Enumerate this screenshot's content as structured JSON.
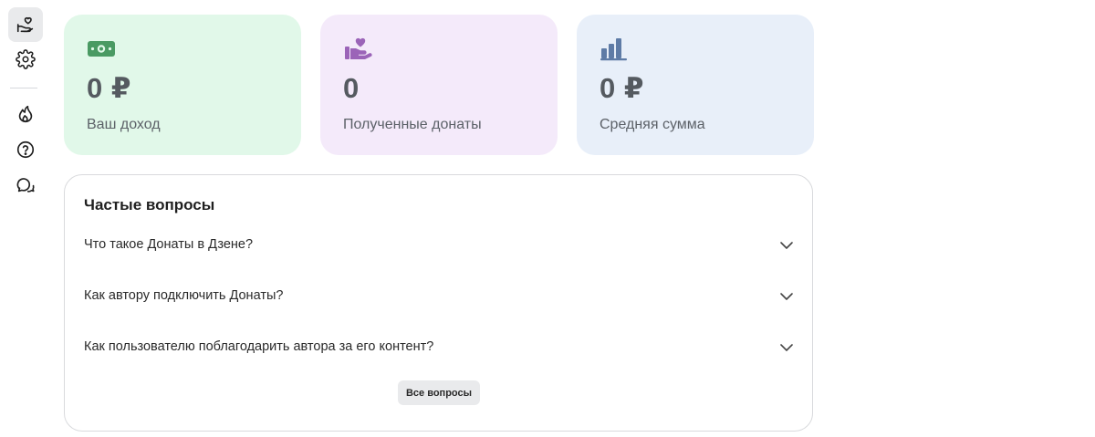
{
  "sidebar": {
    "items": [
      {
        "icon": "donate-hand-icon",
        "active": true
      },
      {
        "icon": "gear-icon",
        "active": false
      },
      {
        "icon": "flame-icon",
        "active": false
      },
      {
        "icon": "question-circle-icon",
        "active": false
      },
      {
        "icon": "chat-bubbles-icon",
        "active": false
      }
    ]
  },
  "stats": {
    "income": {
      "value": "0 ₽",
      "label": "Ваш доход",
      "icon": "money-bill-icon",
      "color": "#4a9a63"
    },
    "donates": {
      "value": "0",
      "label": "Полученные донаты",
      "icon": "hand-heart-icon",
      "color": "#9b64b8"
    },
    "average": {
      "value": "0 ₽",
      "label": "Средняя сумма",
      "icon": "bar-chart-icon",
      "color": "#5e7ba6"
    }
  },
  "faq": {
    "title": "Частые вопросы",
    "items": [
      {
        "question": "Что такое Донаты в Дзене?"
      },
      {
        "question": "Как автору подключить Донаты?"
      },
      {
        "question": "Как пользователю поблагодарить автора за его контент?"
      }
    ],
    "all_button_label": "Все вопросы"
  }
}
